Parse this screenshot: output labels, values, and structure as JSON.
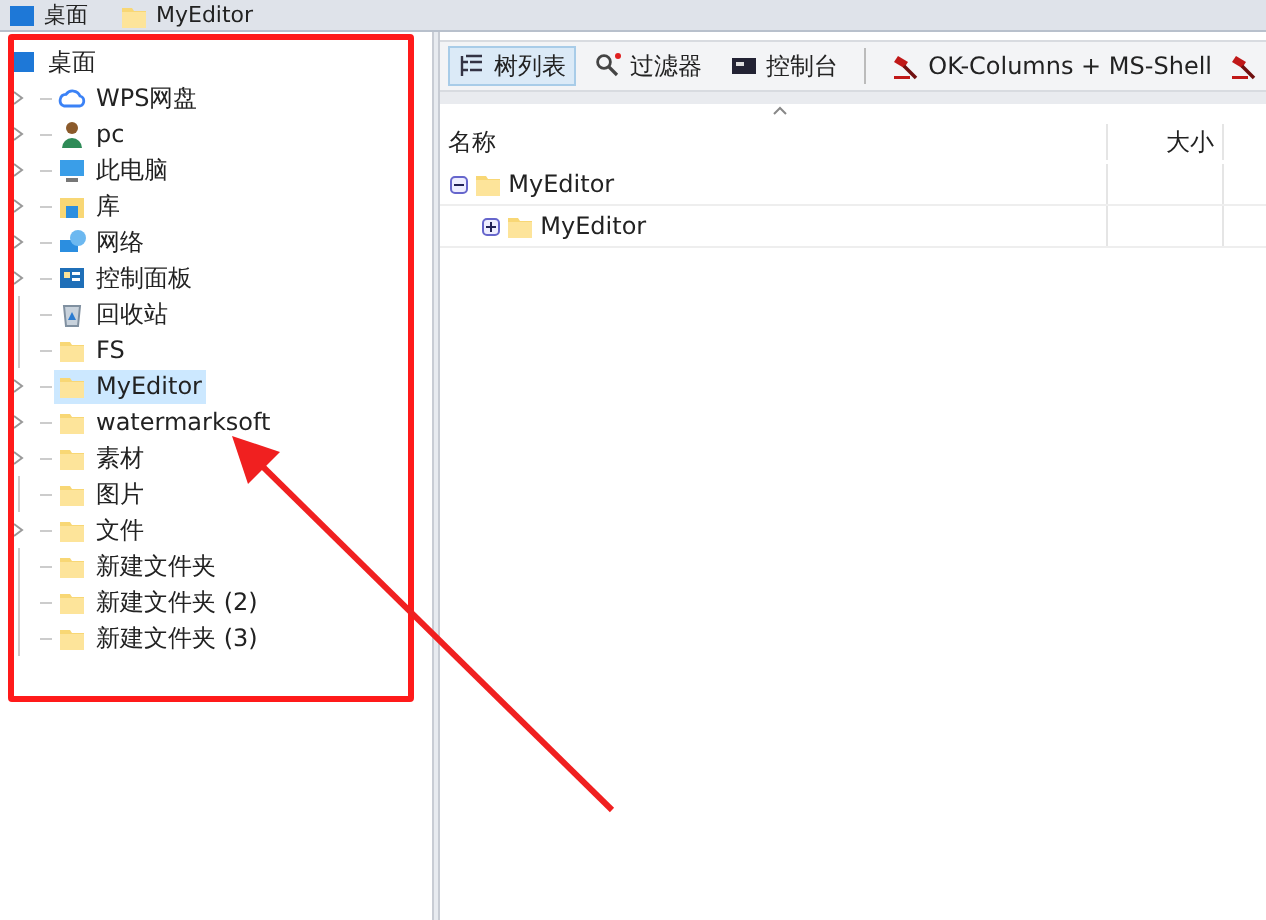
{
  "breadcrumbs": [
    {
      "label": "桌面",
      "kind": "desktop"
    },
    {
      "label": "MyEditor",
      "kind": "folder"
    }
  ],
  "tree": {
    "label": "桌面",
    "kind": "desktop",
    "children": [
      {
        "label": "WPS网盘",
        "kind": "cloud",
        "expandable": true,
        "selected": false
      },
      {
        "label": "pc",
        "kind": "user",
        "expandable": true,
        "selected": false
      },
      {
        "label": "此电脑",
        "kind": "computer",
        "expandable": true,
        "selected": false
      },
      {
        "label": "库",
        "kind": "library",
        "expandable": true,
        "selected": false
      },
      {
        "label": "网络",
        "kind": "network",
        "expandable": true,
        "selected": false
      },
      {
        "label": "控制面板",
        "kind": "panel",
        "expandable": true,
        "selected": false
      },
      {
        "label": "回收站",
        "kind": "bin",
        "expandable": false,
        "selected": false
      },
      {
        "label": "FS",
        "kind": "folder",
        "expandable": false,
        "selected": false
      },
      {
        "label": "MyEditor",
        "kind": "folder",
        "expandable": true,
        "selected": true
      },
      {
        "label": "watermarksoft",
        "kind": "folder",
        "expandable": true,
        "selected": false
      },
      {
        "label": "素材",
        "kind": "folder",
        "expandable": true,
        "selected": false
      },
      {
        "label": "图片",
        "kind": "folder",
        "expandable": false,
        "selected": false
      },
      {
        "label": "文件",
        "kind": "folder",
        "expandable": true,
        "selected": false
      },
      {
        "label": "新建文件夹",
        "kind": "folder",
        "expandable": false,
        "selected": false
      },
      {
        "label": "新建文件夹 (2)",
        "kind": "folder",
        "expandable": false,
        "selected": false
      },
      {
        "label": "新建文件夹 (3)",
        "kind": "folder",
        "expandable": false,
        "selected": false
      }
    ]
  },
  "toolbar": [
    {
      "label": "树列表",
      "kind": "tree",
      "selected": true
    },
    {
      "label": "过滤器",
      "kind": "filter",
      "selected": false
    },
    {
      "label": "控制台",
      "kind": "console",
      "selected": false
    },
    {
      "label": "OK-Columns + MS-Shell",
      "kind": "hammer",
      "selected": false
    }
  ],
  "table": {
    "columns": [
      "名称",
      "大小"
    ],
    "rows": [
      {
        "name": "MyEditor",
        "expanded": true,
        "children": [
          {
            "name": "MyEditor",
            "expanded": false
          }
        ]
      }
    ]
  }
}
